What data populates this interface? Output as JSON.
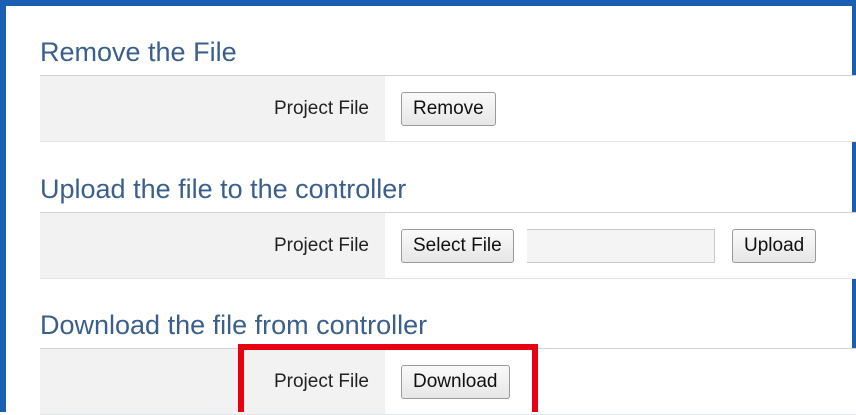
{
  "sections": [
    {
      "title": "Remove the File",
      "label": "Project File",
      "buttons": [
        "Remove"
      ]
    },
    {
      "title": "Upload the file to the controller",
      "label": "Project File",
      "buttons": [
        "Select File",
        "Upload"
      ],
      "file_name": ""
    },
    {
      "title": "Download the file from controller",
      "label": "Project File",
      "buttons": [
        "Download"
      ]
    }
  ],
  "colors": {
    "frame_border": "#1a5fb4",
    "section_title": "#3b5f8c",
    "highlight": "#e60012"
  }
}
